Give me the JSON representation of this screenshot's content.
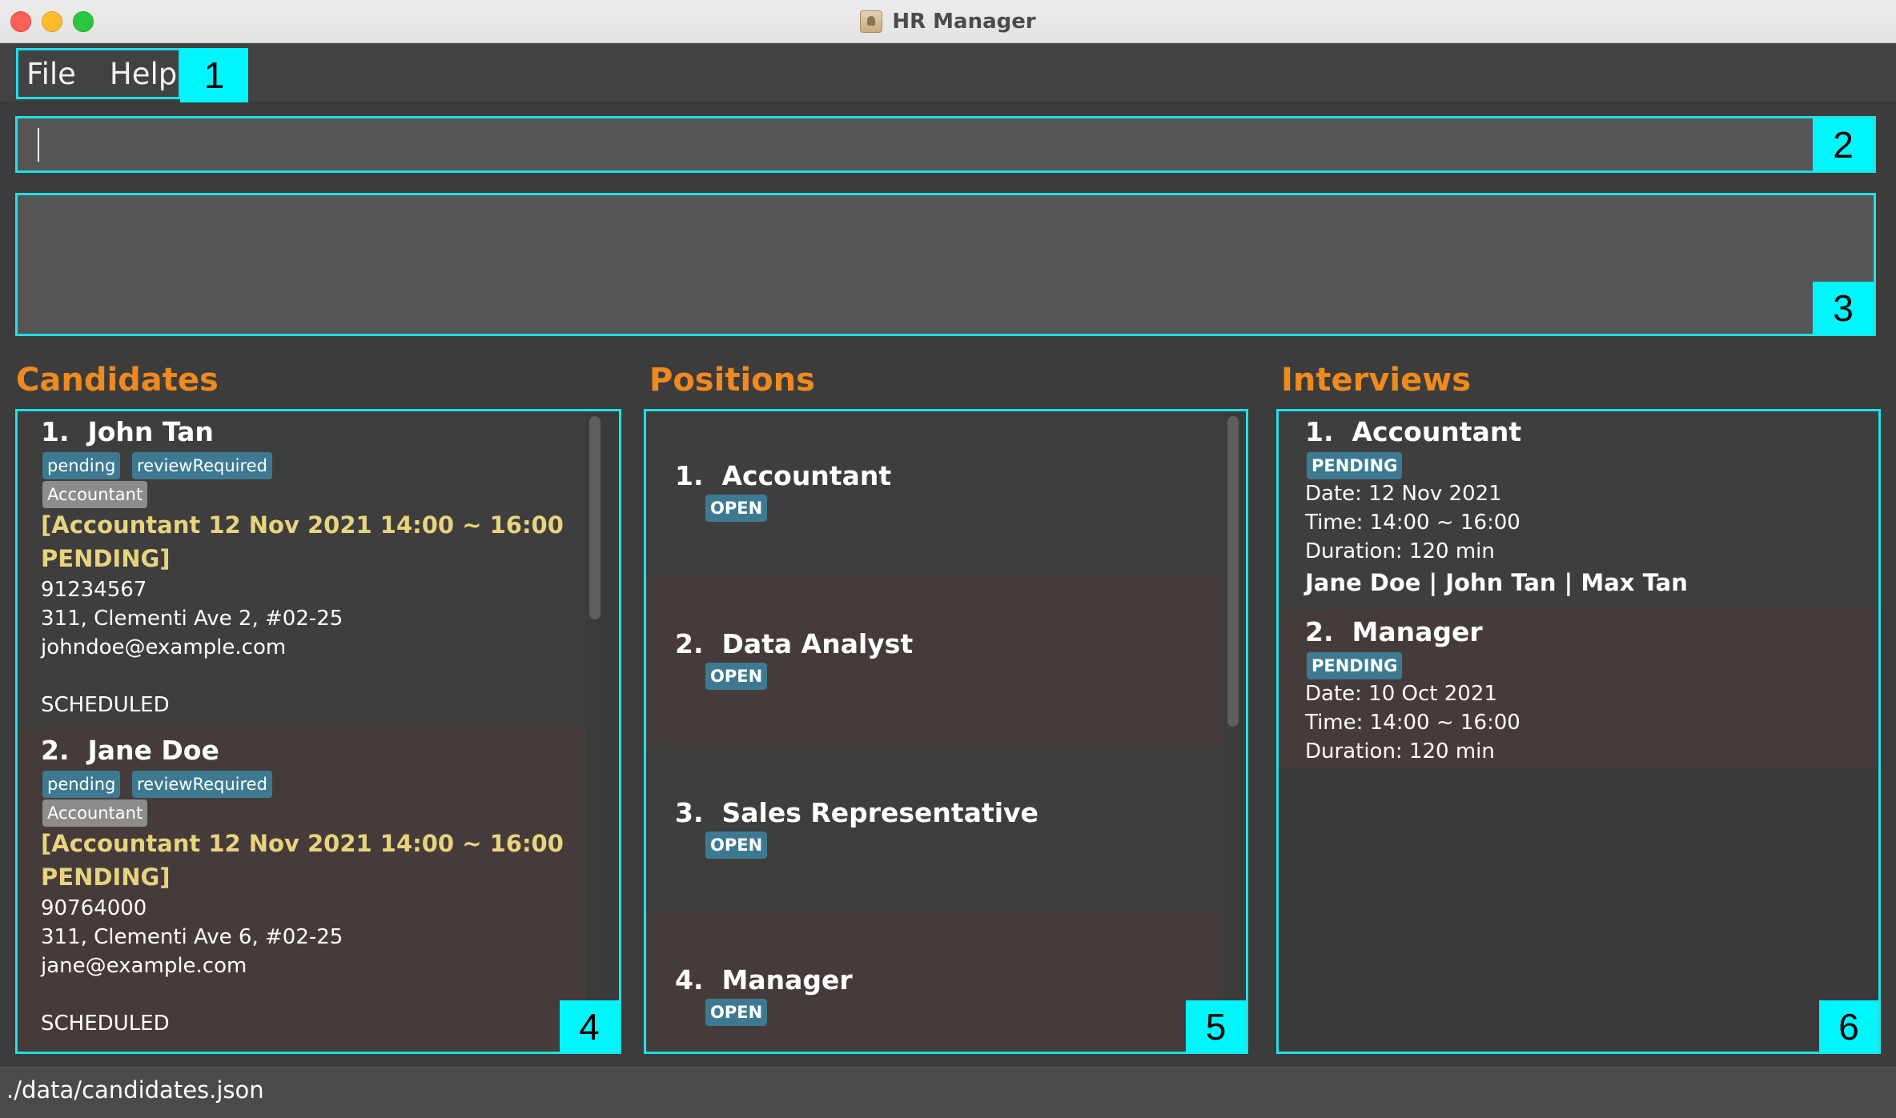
{
  "window": {
    "title": "HR Manager"
  },
  "menu": {
    "items": [
      "File",
      "Help"
    ]
  },
  "command": {
    "value": "",
    "placeholder": ""
  },
  "result": {
    "text": ""
  },
  "callouts": [
    "1",
    "2",
    "3",
    "4",
    "5",
    "6"
  ],
  "sections": {
    "candidates": "Candidates",
    "positions": "Positions",
    "interviews": "Interviews"
  },
  "candidates": [
    {
      "index": "1.",
      "name": "John Tan",
      "tags": [
        "pending",
        "reviewRequired"
      ],
      "position": "Accountant",
      "interview_line1": "[Accountant 12 Nov 2021 14:00 ~ 16:00",
      "interview_line2": "PENDING]",
      "phone": "91234567",
      "address": "311, Clementi Ave 2, #02-25",
      "email": "johndoe@example.com",
      "status": "SCHEDULED"
    },
    {
      "index": "2.",
      "name": "Jane Doe",
      "tags": [
        "pending",
        "reviewRequired"
      ],
      "position": "Accountant",
      "interview_line1": "[Accountant 12 Nov 2021 14:00 ~ 16:00",
      "interview_line2": "PENDING]",
      "phone": "90764000",
      "address": "311, Clementi Ave 6, #02-25",
      "email": "jane@example.com",
      "status": "SCHEDULED"
    }
  ],
  "positions": [
    {
      "index": "1.",
      "title": "Accountant",
      "status": "OPEN"
    },
    {
      "index": "2.",
      "title": "Data Analyst",
      "status": "OPEN"
    },
    {
      "index": "3.",
      "title": "Sales Representative",
      "status": "OPEN"
    },
    {
      "index": "4.",
      "title": "Manager",
      "status": "OPEN"
    }
  ],
  "interviews": [
    {
      "index": "1.",
      "title": "Accountant",
      "status": "PENDING",
      "date": "Date: 12 Nov 2021",
      "time": "Time: 14:00 ~ 16:00",
      "duration": "Duration: 120 min",
      "candidates": "Jane Doe | John Tan | Max Tan"
    },
    {
      "index": "2.",
      "title": "Manager",
      "status": "PENDING",
      "date": "Date: 10 Oct 2021",
      "time": "Time: 14:00 ~ 16:00",
      "duration": "Duration: 120 min"
    }
  ],
  "statusbar": {
    "path": "./data/candidates.json"
  },
  "colors": {
    "callout": "#00f6fb",
    "frame": "#1fe0e6",
    "section_header": "#f08a1e",
    "tag_blue": "#3d7a92",
    "tag_grey": "#8c8c8c",
    "interview_highlight": "#e8d37e"
  }
}
